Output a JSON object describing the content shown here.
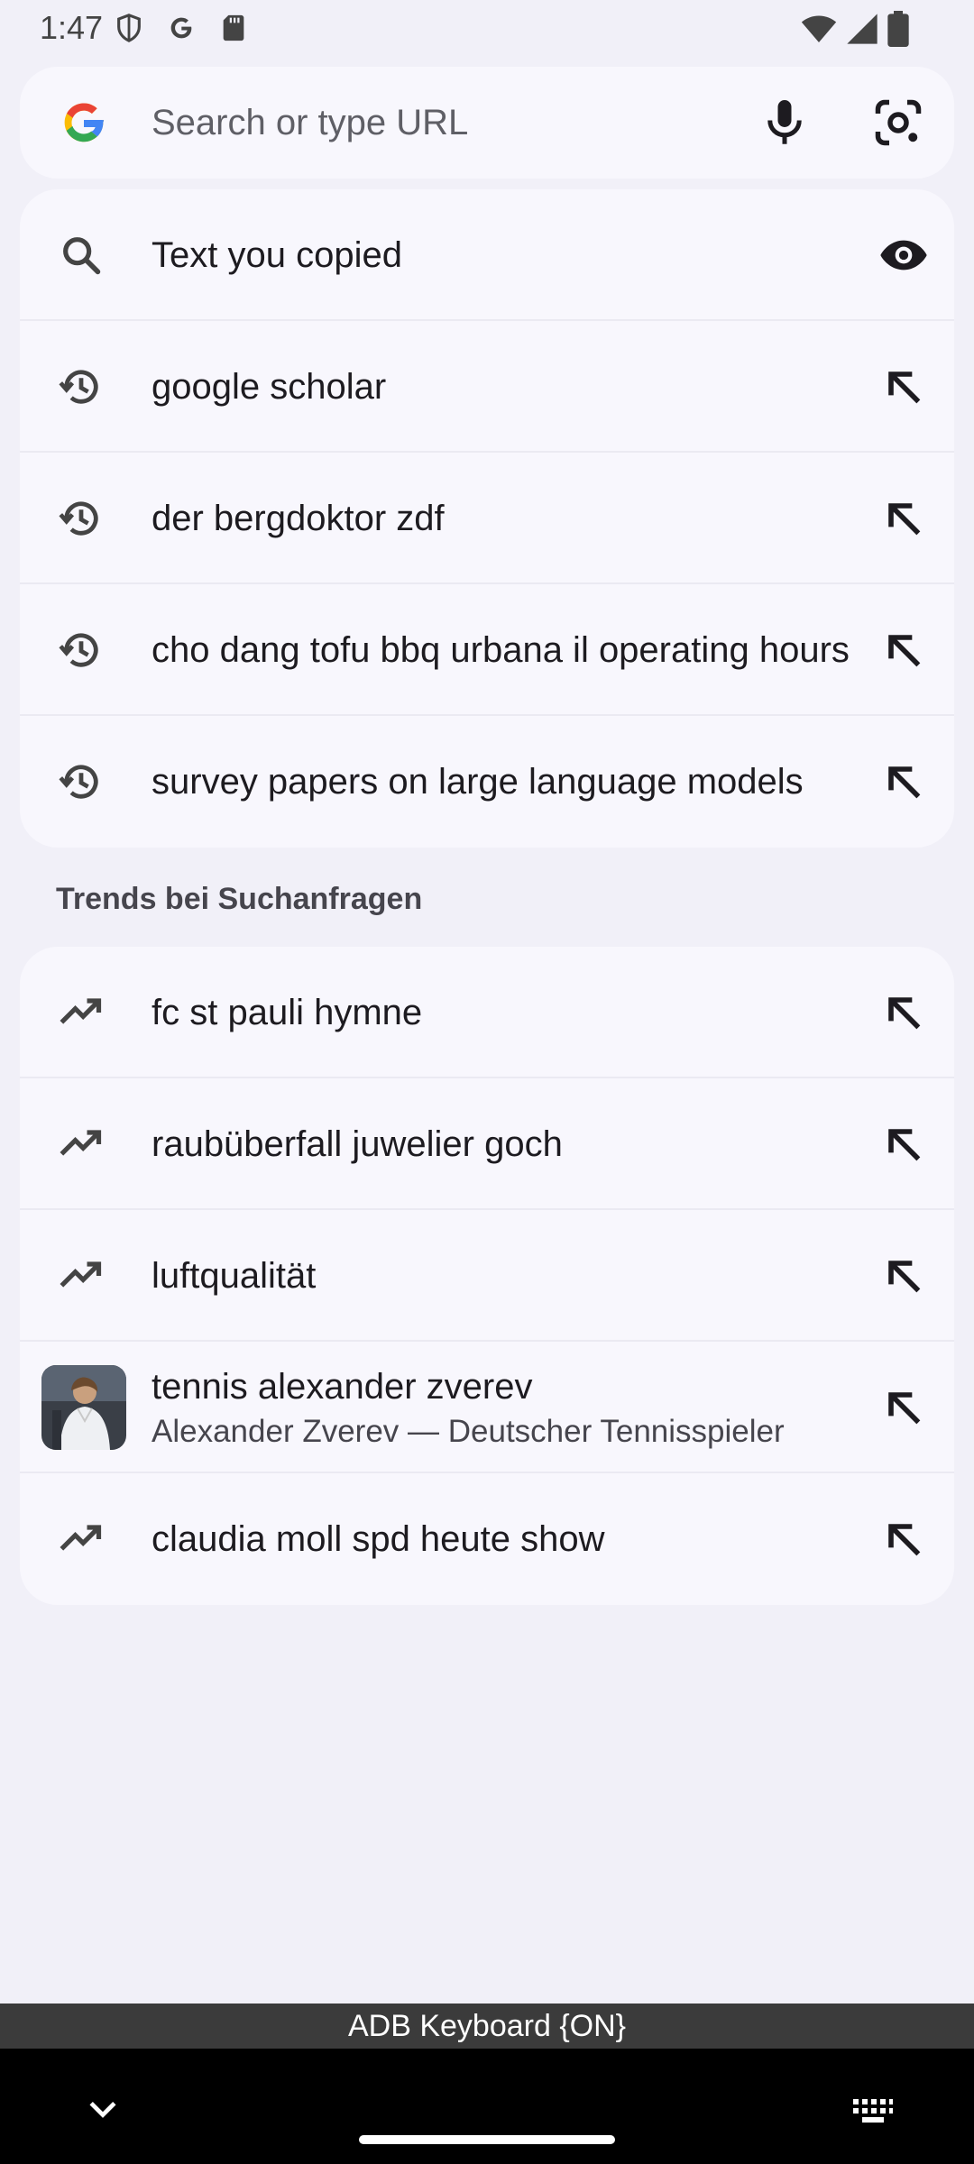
{
  "status_bar": {
    "time": "1:47",
    "left_icons": [
      "shield-icon",
      "google-icon",
      "sd-card-icon"
    ],
    "right_icons": [
      "wifi-icon",
      "signal-icon",
      "battery-icon"
    ]
  },
  "search": {
    "placeholder": "Search or type URL",
    "value": ""
  },
  "clipboard": {
    "label": "Text you copied"
  },
  "history": [
    {
      "label": "google scholar"
    },
    {
      "label": "der bergdoktor zdf"
    },
    {
      "label": "cho dang tofu bbq urbana il operating hours"
    },
    {
      "label": "survey papers on large language models"
    }
  ],
  "trends": {
    "heading": "Trends bei Suchanfragen",
    "items": [
      {
        "label": "fc st pauli hymne"
      },
      {
        "label": "raubüberfall juwelier goch"
      },
      {
        "label": "luftqualität"
      },
      {
        "label": "tennis alexander zverev",
        "subtitle": "Alexander Zverev — Deutscher Tennisspieler"
      },
      {
        "label": "claudia moll spd heute show"
      }
    ]
  },
  "keyboard": {
    "status": "ADB Keyboard {ON}"
  },
  "colors": {
    "background": "#f1f0f8",
    "card": "#f8f7fd",
    "divider": "#ebeaf2",
    "icon": "#444444",
    "google_blue": "#4285F4",
    "google_red": "#EA4335",
    "google_yellow": "#FBBC05",
    "google_green": "#34A853"
  }
}
